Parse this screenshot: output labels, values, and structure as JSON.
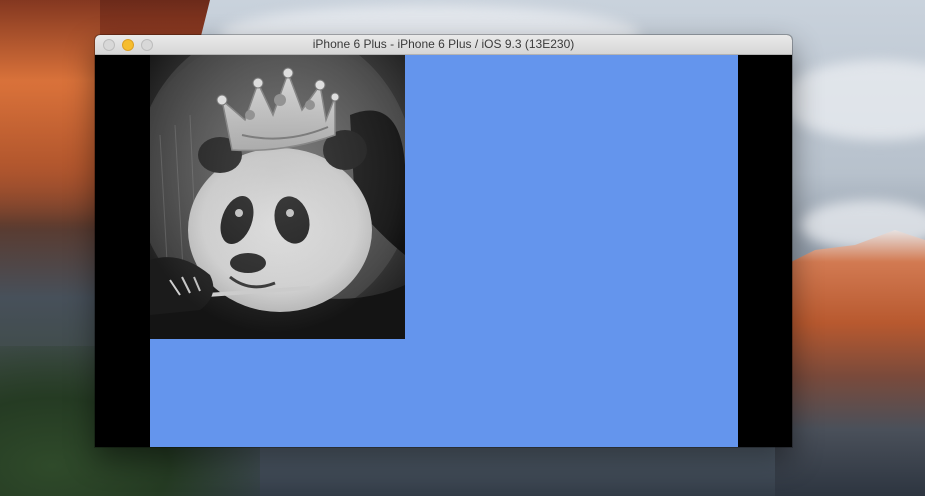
{
  "window": {
    "title": "iPhone 6 Plus - iPhone 6 Plus / iOS 9.3 (13E230)"
  },
  "screen": {
    "background_color": "#6495ed",
    "image_icon": "crowned-panda-image"
  }
}
